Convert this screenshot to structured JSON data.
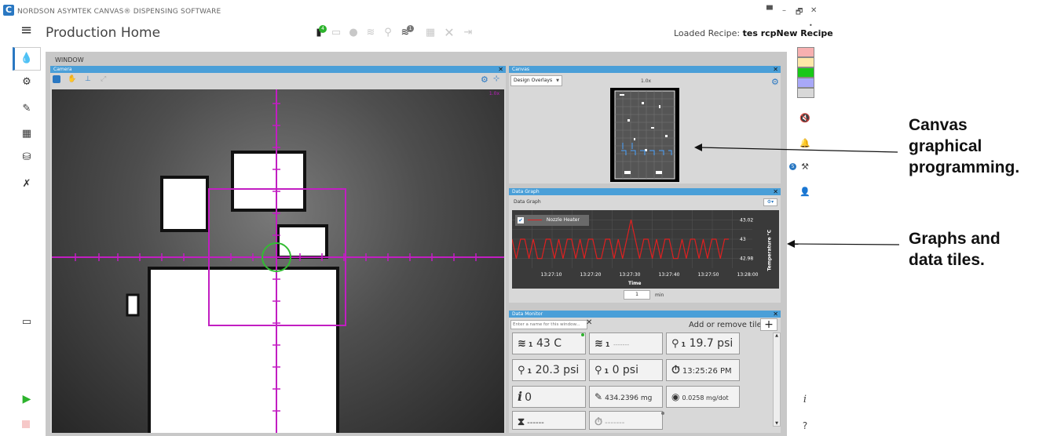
{
  "window": {
    "title": "NORDSON ASYMTEK CANVAS® DISPENSING SOFTWARE",
    "controls": [
      "▀",
      "–",
      "🗗",
      "✕"
    ]
  },
  "appbar": {
    "page_title": "Production Home",
    "loaded_label": "Loaded Recipe:",
    "loaded_value": "tes rcpNew Recipe",
    "badge_1": "4",
    "badge_2": "1"
  },
  "workspace": {
    "menu_label": "WINDOW"
  },
  "camera": {
    "title": "Camera",
    "zoom": "1.0x"
  },
  "canvas": {
    "title": "Canvas",
    "overlay_select": "Design Overlays",
    "zoom": "1.0x"
  },
  "data_graph": {
    "title": "Data Graph",
    "subtitle": "Data Graph",
    "legend": "Nozzle Heater",
    "y_label": "Temperature °C",
    "x_label": "Time",
    "window_value": "1",
    "window_unit": "min",
    "chart_data": {
      "type": "line",
      "x": [
        "13:27:10",
        "13:27:20",
        "13:27:30",
        "13:27:40",
        "13:27:50",
        "13:28:00"
      ],
      "y_ticks": [
        43.02,
        43,
        42.98
      ],
      "series": [
        {
          "name": "Nozzle Heater",
          "color": "#e02020"
        }
      ]
    }
  },
  "data_monitor": {
    "title": "Data Monitor",
    "name_placeholder": "Enter a name for this window...",
    "add_remove_label": "Add or remove tiles",
    "tiles": [
      {
        "sub": "1",
        "sup": "H",
        "value": "43 C"
      },
      {
        "sub": "1",
        "sup": "C",
        "value": "-------"
      },
      {
        "sub": "1",
        "sup": "H",
        "value": "19.7 psi"
      },
      {
        "sub": "1",
        "sup": "H",
        "value": "20.3 psi"
      },
      {
        "sub": "1",
        "sup": "H",
        "value": "0 psi"
      },
      {
        "value": "13:25:26 PM"
      },
      {
        "value": "0"
      },
      {
        "value": "434.2396 mg"
      },
      {
        "value": "0.0258 mg/dot"
      },
      {
        "value": "------"
      },
      {
        "value": "-------"
      }
    ]
  },
  "swatch_colors": [
    "#f7b0b0",
    "#fde7a8",
    "#18c818",
    "#a8a8f8",
    "#d8d8d8"
  ],
  "right_badge": "5",
  "annotations": {
    "canvas_line1": "Canvas",
    "canvas_line2": "graphical",
    "canvas_line3": "programming.",
    "graphs_line1": "Graphs and",
    "graphs_line2": "data tiles."
  }
}
